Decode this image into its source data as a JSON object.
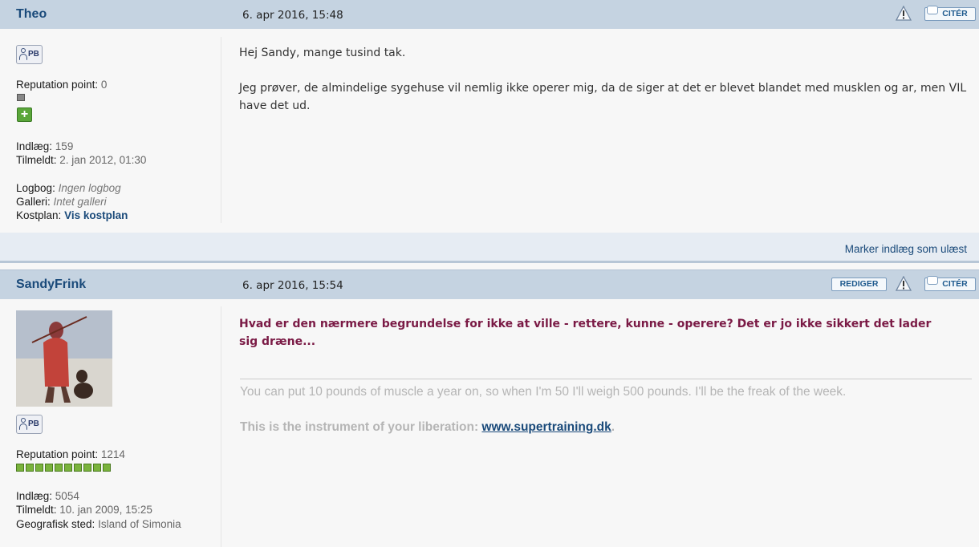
{
  "posts": [
    {
      "author": "Theo",
      "date": "6. apr 2016, 15:48",
      "quote_label": "CITÉR",
      "pb_label": "PB",
      "stats": {
        "reputation_label": "Reputation point",
        "reputation_value": "0",
        "posts_label": "Indlæg",
        "posts_value": "159",
        "joined_label": "Tilmeldt",
        "joined_value": "2. jan 2012, 01:30",
        "logbook_label": "Logbog",
        "logbook_value": "Ingen logbog",
        "gallery_label": "Galleri",
        "gallery_value": "Intet galleri",
        "diet_label": "Kostplan",
        "diet_value": "Vis kostplan"
      },
      "message": [
        "Hej Sandy, mange tusind tak.",
        "Jeg prøver, de almindelige sygehuse vil nemlig ikke operer mig, da de siger at det er blevet blandet med musklen og ar, men VIL have det ud."
      ],
      "footer_link": "Marker indlæg som ulæst"
    },
    {
      "author": "SandyFrink",
      "date": "6. apr 2016, 15:54",
      "edit_label": "REDIGER",
      "quote_label": "CITÉR",
      "pb_label": "PB",
      "stats": {
        "reputation_label": "Reputation point",
        "reputation_value": "1214",
        "reputation_boxes": 10,
        "posts_label": "Indlæg",
        "posts_value": "5054",
        "joined_label": "Tilmeldt",
        "joined_value": "10. jan 2009, 15:25",
        "location_label": "Geografisk sted",
        "location_value": "Island of Simonia"
      },
      "message": "Hvad er den nærmere begrundelse for ikke at ville - rettere, kunne - operere? Det er jo ikke sikkert det lader sig dræne...",
      "signature": {
        "line1": "You can put 10 pounds of muscle a year on, so when I'm 50 I'll weigh 500 pounds. I'll be the freak of the week.",
        "line2_prefix": "This is the instrument of your liberation: ",
        "line2_link": "www.supertraining.dk",
        "line2_suffix": "."
      }
    }
  ],
  "colors": {
    "header_bg": "#c5d3e1",
    "author": "#1a4a7a",
    "quote_text": "#7a1a45",
    "footer_bg": "#e6ecf3"
  }
}
